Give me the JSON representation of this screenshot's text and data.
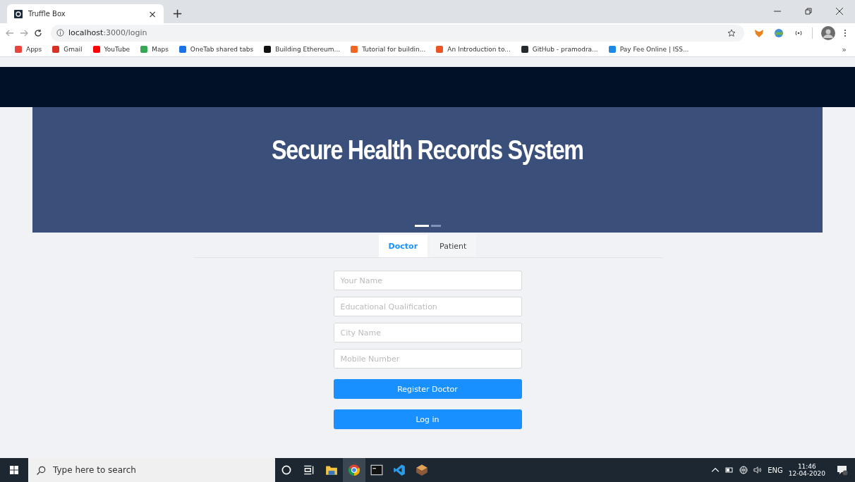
{
  "browser": {
    "tab": {
      "title": "Truffle Box",
      "close": "×"
    },
    "new_tab": "+",
    "url_host": "localhost",
    "url_path": ":3000/login",
    "bookmarks": [
      {
        "label": "Apps"
      },
      {
        "label": "Gmail"
      },
      {
        "label": "YouTube"
      },
      {
        "label": "Maps"
      },
      {
        "label": "OneTab shared tabs"
      },
      {
        "label": "Building Ethereum..."
      },
      {
        "label": "Tutorial for buildin..."
      },
      {
        "label": "An Introduction to..."
      },
      {
        "label": "GitHub - pramodra..."
      },
      {
        "label": "Pay Fee Online | ISS..."
      }
    ],
    "bookmarks_more": "»"
  },
  "banner": {
    "title": "Secure Health Records System",
    "indicators": [
      {
        "selected": true
      },
      {
        "selected": false
      }
    ]
  },
  "tabs": [
    {
      "label": "Doctor",
      "selected": true
    },
    {
      "label": "Patient",
      "selected": false
    }
  ],
  "fields": [
    {
      "placeholder": "Your Name"
    },
    {
      "placeholder": "Educational Qualification"
    },
    {
      "placeholder": "City Name"
    },
    {
      "placeholder": "Mobile Number"
    }
  ],
  "buttons": [
    "Register Doctor",
    "Log in"
  ],
  "taskbar": {
    "search_placeholder": "Type here to search",
    "language": "ENG",
    "time": "11:46",
    "date": "12-04-2020"
  }
}
